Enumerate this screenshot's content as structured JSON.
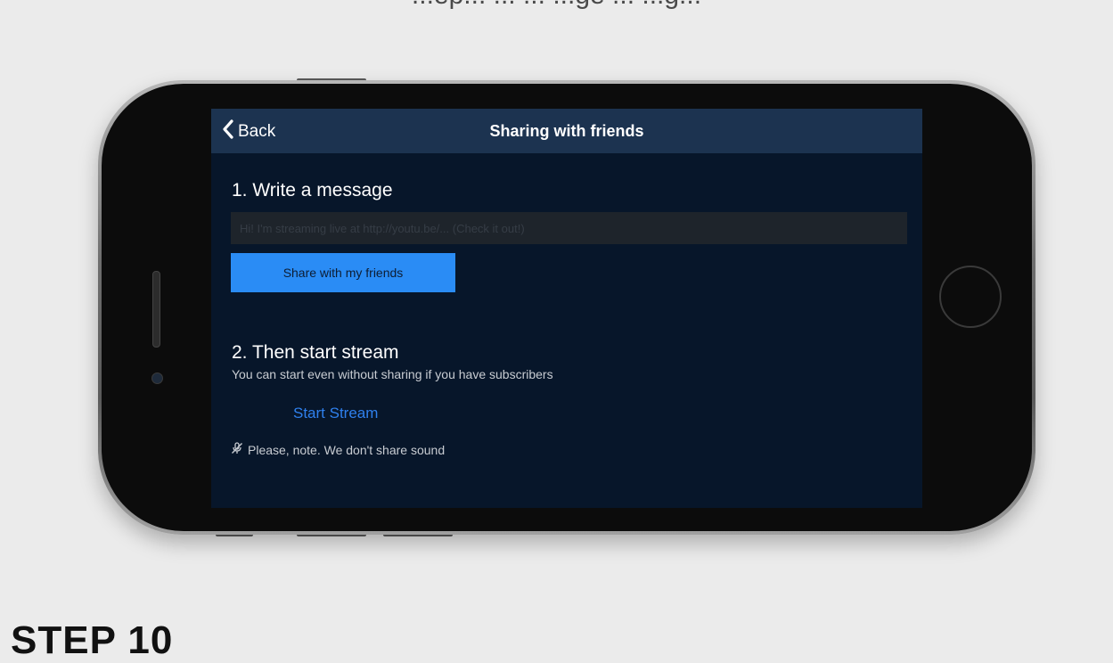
{
  "page": {
    "header_text": "...ep... ... ... ...ge ... ...g...",
    "step_label": "STEP 10"
  },
  "screen": {
    "nav": {
      "back_label": "Back",
      "title": "Sharing with friends"
    },
    "section1": {
      "title": "1. Write a message",
      "message_value": "Hi! I'm streaming live at http://youtu.be/... (Check it out!)",
      "share_button_label": "Share with my friends"
    },
    "section2": {
      "title": "2. Then start stream",
      "subtitle": "You can start even without sharing if you have subscribers",
      "start_stream_label": "Start Stream",
      "note": "Please, note. We don't share sound"
    }
  },
  "colors": {
    "screen_bg": "#07162a",
    "navbar_bg": "#1c3350",
    "accent": "#2a8cf5",
    "link": "#2f80ed"
  },
  "icons": {
    "back": "chevron-left-icon",
    "note": "mute-icon"
  }
}
